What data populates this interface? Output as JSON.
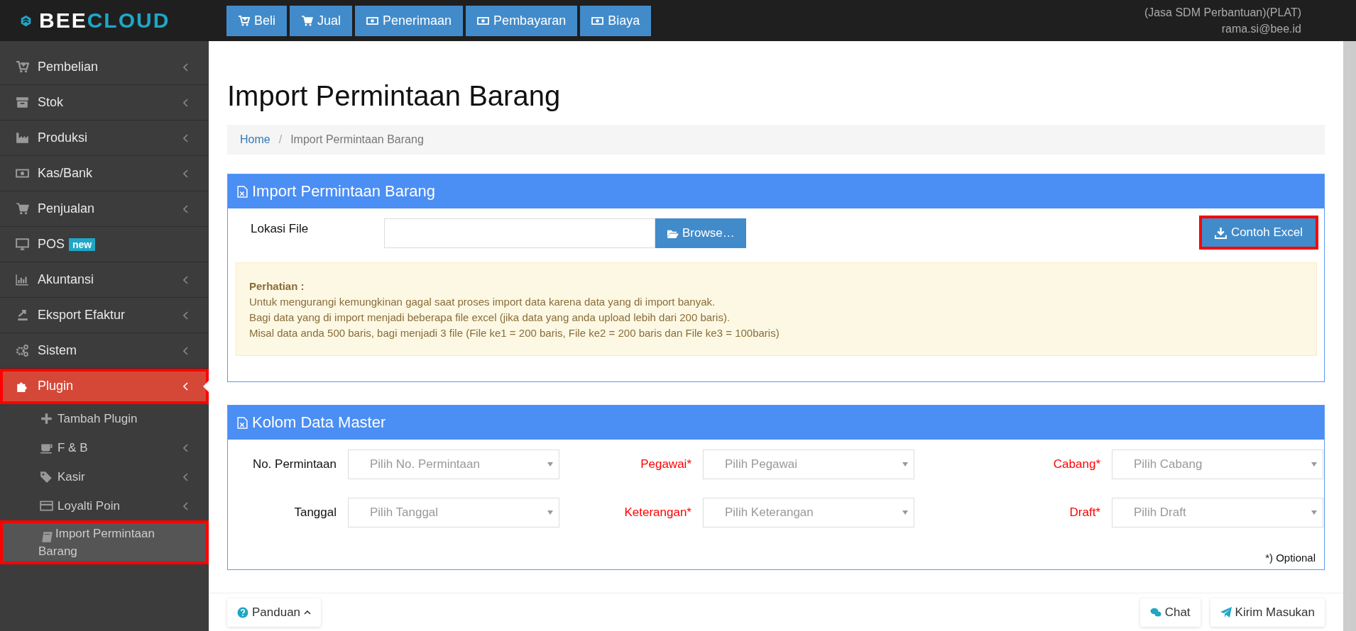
{
  "logo": {
    "text_a": "BEE",
    "text_b": "CLOUD"
  },
  "top_buttons": [
    {
      "label": "Beli"
    },
    {
      "label": "Jual"
    },
    {
      "label": "Penerimaan"
    },
    {
      "label": "Pembayaran"
    },
    {
      "label": "Biaya"
    }
  ],
  "user": {
    "company": "(Jasa SDM Perbantuan)(PLAT)",
    "email": "rama.si@bee.id"
  },
  "sidebar": {
    "items": [
      {
        "label": "Pembelian",
        "selected": false,
        "highlighted": false,
        "has_caret": true
      },
      {
        "label": "Stok",
        "selected": false,
        "highlighted": false,
        "has_caret": true
      },
      {
        "label": "Produksi",
        "selected": false,
        "highlighted": false,
        "has_caret": true
      },
      {
        "label": "Kas/Bank",
        "selected": false,
        "highlighted": false,
        "has_caret": true
      },
      {
        "label": "Penjualan",
        "selected": false,
        "highlighted": false,
        "has_caret": true
      },
      {
        "label": "POS",
        "badge": "new",
        "selected": false,
        "highlighted": false,
        "has_caret": false
      },
      {
        "label": "Akuntansi",
        "selected": false,
        "highlighted": false,
        "has_caret": true
      },
      {
        "label": "Eksport Efaktur",
        "selected": false,
        "highlighted": false,
        "has_caret": true
      },
      {
        "label": "Sistem",
        "selected": false,
        "highlighted": false,
        "has_caret": true
      },
      {
        "label": "Plugin",
        "selected": true,
        "highlighted": true,
        "has_caret": true,
        "children": [
          {
            "label": "Tambah Plugin",
            "selected": false,
            "highlighted": false,
            "has_caret": false
          },
          {
            "label": "F & B",
            "selected": false,
            "highlighted": false,
            "has_caret": true
          },
          {
            "label": "Kasir",
            "selected": false,
            "highlighted": false,
            "has_caret": true
          },
          {
            "label": "Loyalti Poin",
            "selected": false,
            "highlighted": false,
            "has_caret": true
          },
          {
            "label": "Import Permintaan Barang",
            "selected": true,
            "highlighted": true,
            "has_caret": false
          }
        ]
      }
    ]
  },
  "page_title": "Import Permintaan Barang",
  "breadcrumb": {
    "separator": "/",
    "items": [
      {
        "label": "Home",
        "link": true
      },
      {
        "label": "Import Permintaan Barang",
        "link": false
      }
    ]
  },
  "import_panel": {
    "title": "Import Permintaan Barang",
    "file_label": "Lokasi File",
    "browse_button": "Browse…",
    "sample_button": {
      "label": "Contoh Excel",
      "highlighted": true
    },
    "notice": {
      "heading": "Perhatian :",
      "lines": [
        "Untuk mengurangi kemungkinan gagal saat proses import data karena data yang di import banyak.",
        "Bagi data yang di import menjadi beberapa file excel (jika data yang anda upload lebih dari 200 baris).",
        "Misal data anda 500 baris, bagi menjadi 3 file (File ke1 = 200 baris, File ke2 = 200 baris dan File ke3 = 100baris)"
      ]
    }
  },
  "master_panel": {
    "title": "Kolom Data Master",
    "fields": [
      {
        "label": "No. Permintaan",
        "placeholder": "Pilih No. Permintaan",
        "required": false
      },
      {
        "label": "Pegawai*",
        "placeholder": "Pilih Pegawai",
        "required": true
      },
      {
        "label": "Cabang*",
        "placeholder": "Pilih Cabang",
        "required": true
      },
      {
        "label": "Tanggal",
        "placeholder": "Pilih Tanggal",
        "required": false
      },
      {
        "label": "Keterangan*",
        "placeholder": "Pilih Keterangan",
        "required": true
      },
      {
        "label": "Draft*",
        "placeholder": "Pilih Draft",
        "required": true
      }
    ],
    "note": "*) Optional"
  },
  "footer": {
    "guide_button": "Panduan",
    "chat_button": "Chat",
    "feedback_button": "Kirim Masukan"
  }
}
